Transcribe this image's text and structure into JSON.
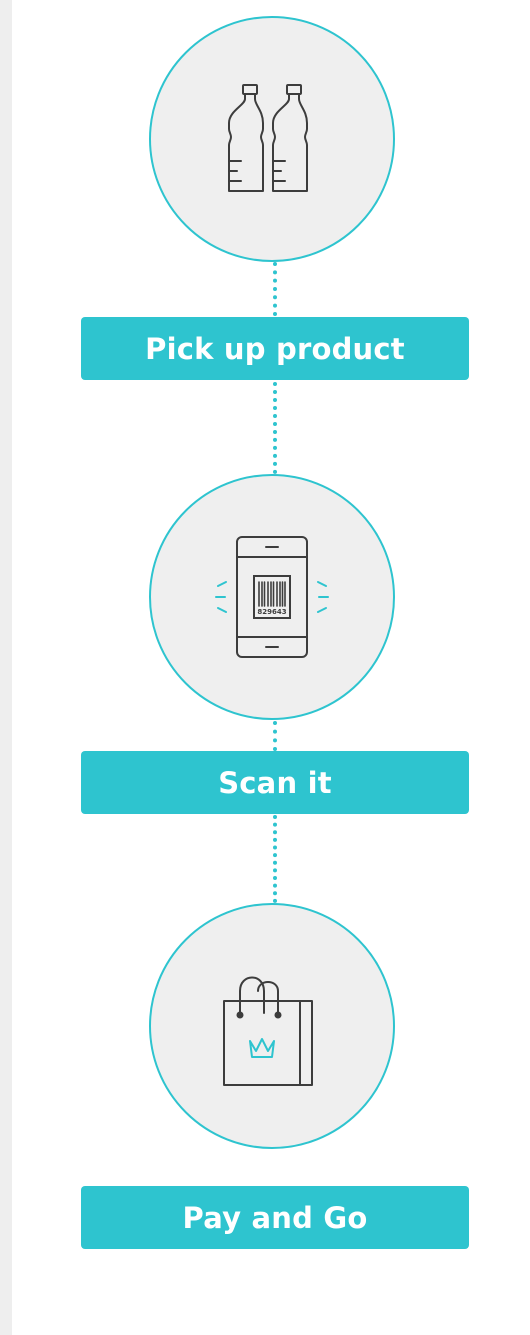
{
  "colors": {
    "accent": "#2ec4cf",
    "circle_fill": "#efefef",
    "icon_stroke": "#3d3d3d",
    "label_text": "#ffffff",
    "left_strip": "#eeeeee"
  },
  "steps": [
    {
      "label": "Pick up product",
      "icon": "bottles-icon"
    },
    {
      "label": "Scan it",
      "icon": "phone-barcode-icon",
      "barcode_number": "829643"
    },
    {
      "label": "Pay and Go",
      "icon": "shopping-bag-crown-icon"
    }
  ]
}
